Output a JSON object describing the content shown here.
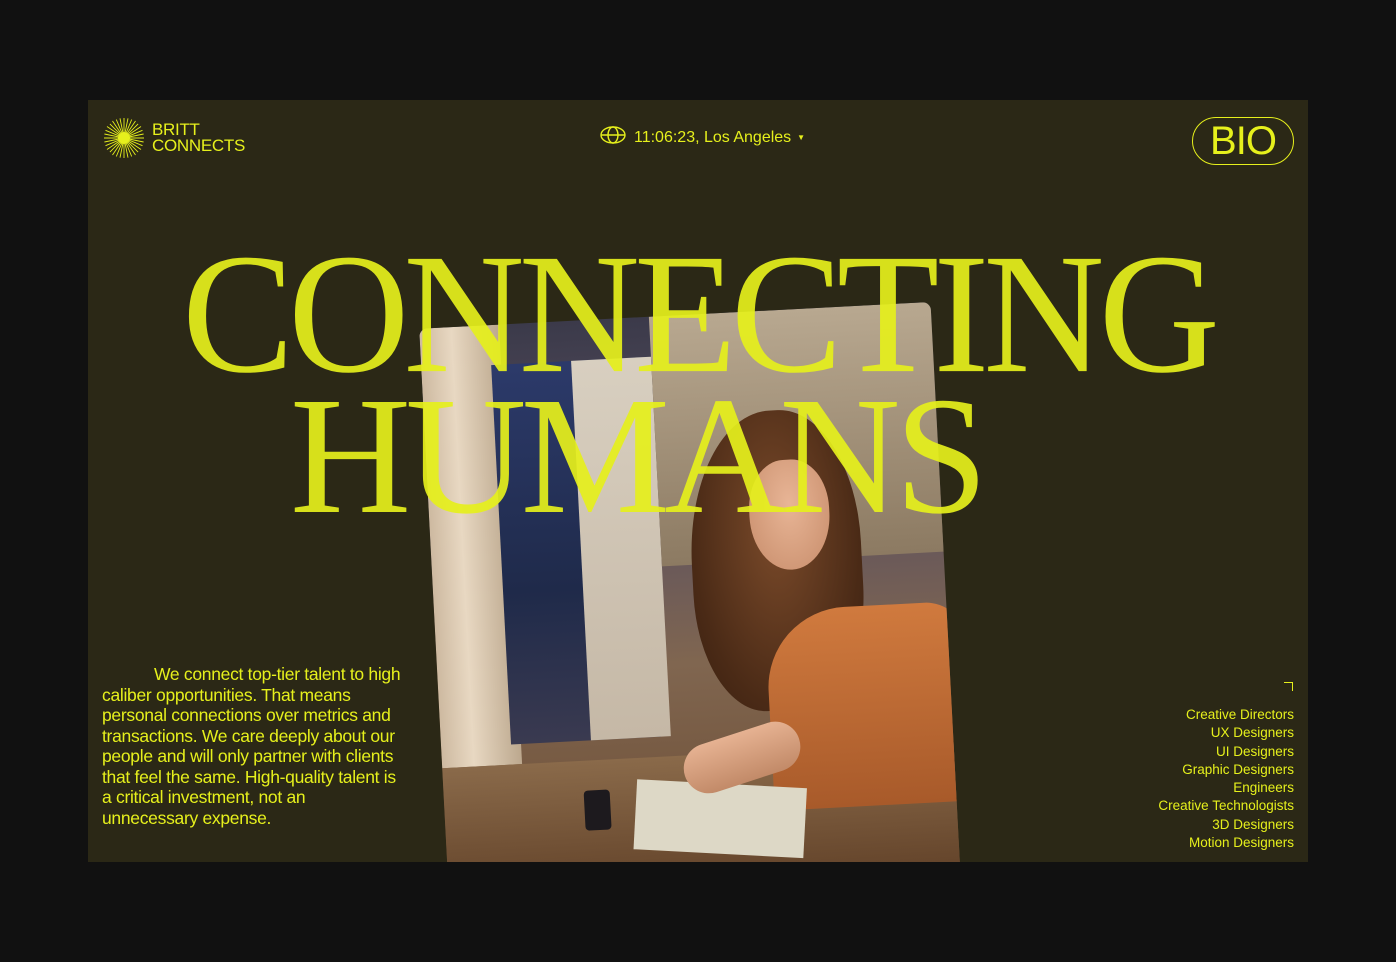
{
  "brand": {
    "name_line1": "BRITT",
    "name_line2": "CONNECTS",
    "logo_icon": "sunburst-icon"
  },
  "clock": {
    "icon": "globe-icon",
    "time_location": "11:06:23, Los Angeles",
    "dropdown_icon": "caret-down-icon"
  },
  "nav": {
    "bio_label": "BIO"
  },
  "hero": {
    "headline_line1": "CONNECTING",
    "headline_line2": "HUMANS",
    "photo_subject": "woman-painting-watercolor-photo"
  },
  "blurb": {
    "text": "We connect top-tier talent to high caliber opportunities. That means personal connections over metrics and transactions. We care deeply about our people and will only partner with clients that feel the same. High-quality talent is a critical investment, not an unnecessary expense."
  },
  "roles": {
    "items": [
      "Creative Directors",
      "UX Designers",
      "UI Designers",
      "Graphic Designers",
      "Engineers",
      "Creative Technologists",
      "3D Designers",
      "Motion Designers"
    ]
  },
  "colors": {
    "page_background": "#111111",
    "panel_background": "#2b2816",
    "accent": "#e6f01c"
  }
}
